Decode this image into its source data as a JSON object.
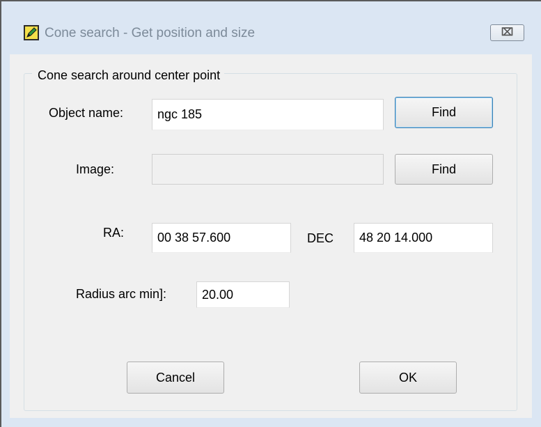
{
  "window": {
    "title": "Cone search - Get position and size",
    "close_glyph": "⌧",
    "app_icon": "edit-icon"
  },
  "group": {
    "title": "Cone search around center point"
  },
  "object": {
    "label": "Object name:",
    "value": "ngc 185",
    "find_label": "Find"
  },
  "image": {
    "label": "Image:",
    "value": "",
    "find_label": "Find"
  },
  "ra": {
    "label": "RA:",
    "value": "00 38 57.600"
  },
  "dec": {
    "label": "DEC",
    "value": "48 20 14.000"
  },
  "radius": {
    "label": "Radius arc min]:",
    "value": "20.00"
  },
  "buttons": {
    "cancel": "Cancel",
    "ok": "OK"
  }
}
